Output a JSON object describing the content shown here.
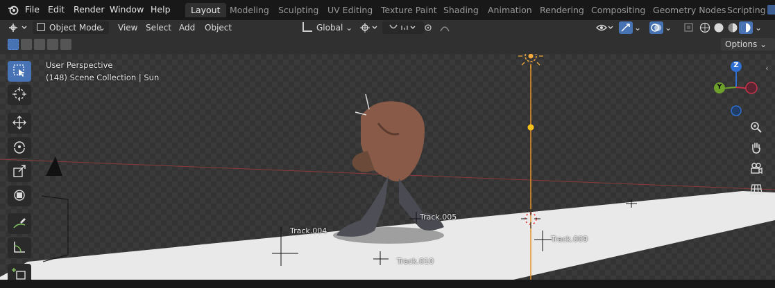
{
  "menu": {
    "file": "File",
    "edit": "Edit",
    "render": "Render",
    "window": "Window",
    "help": "Help"
  },
  "workspaces": [
    "Layout",
    "Modeling",
    "Sculpting",
    "UV Editing",
    "Texture Paint",
    "Shading",
    "Animation",
    "Rendering",
    "Compositing",
    "Geometry Nodes",
    "Scripting"
  ],
  "header": {
    "mode": "Object Mode",
    "view": "View",
    "select": "Select",
    "add": "Add",
    "object": "Object",
    "transform_orientation": "Global",
    "options": "Options"
  },
  "viewport": {
    "perspective": "User Perspective",
    "collection": "(148) Scene Collection | Sun",
    "tracks": [
      "Track.004",
      "Track.005",
      "Track.009",
      "Track.010"
    ]
  },
  "gizmo": {
    "z": "Z",
    "y": "Y"
  },
  "colors": {
    "accent": "#4772b3",
    "sun": "#f5a623",
    "x_axis": "#c8324a",
    "y_axis": "#6ea02c",
    "z_axis": "#2f6fcf"
  },
  "icons": [
    "blender-logo-icon",
    "select-box-icon",
    "cursor-icon",
    "move-icon",
    "rotate-icon",
    "scale-icon",
    "transform-icon",
    "annotate-icon",
    "measure-icon",
    "add-cube-icon",
    "zoom-icon",
    "hand-icon",
    "camera-icon",
    "grid-icon"
  ]
}
